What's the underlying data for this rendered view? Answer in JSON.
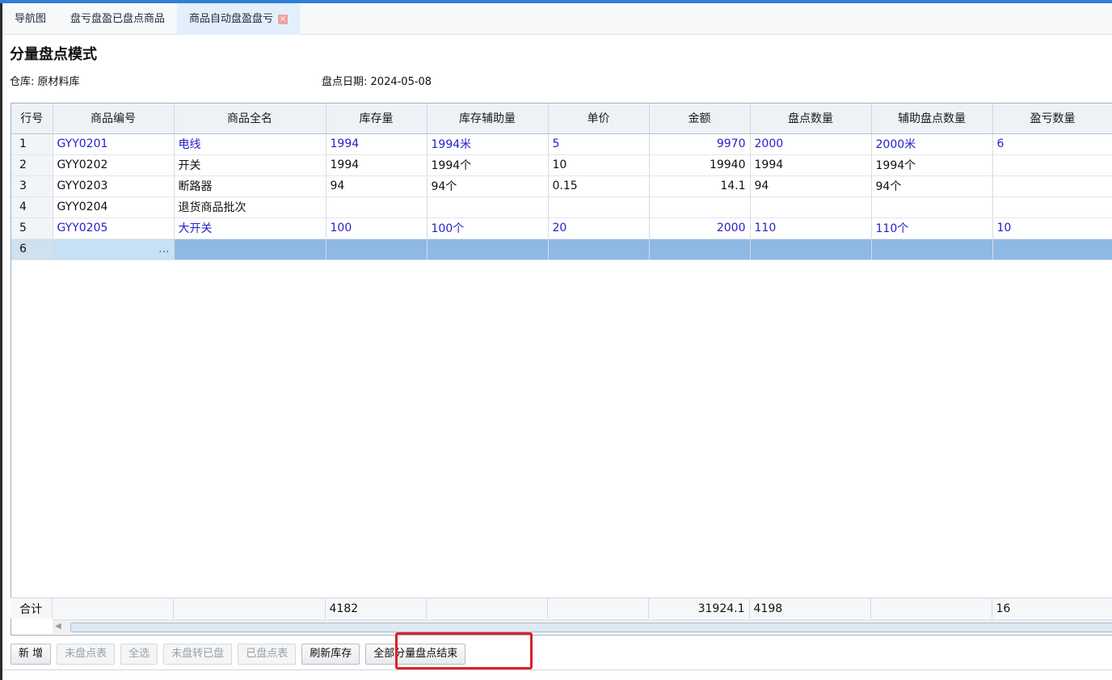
{
  "tabs": [
    {
      "label": "导航图"
    },
    {
      "label": "盘亏盘盈已盘点商品"
    },
    {
      "label": "商品自动盘盈盘亏"
    }
  ],
  "page": {
    "title": "分量盘点模式",
    "warehouse_label": "仓库:",
    "warehouse_value": "原材料库",
    "date_label": "盘点日期:",
    "date_value": "2024-05-08"
  },
  "grid": {
    "columns": [
      "行号",
      "商品编号",
      "商品全名",
      "库存量",
      "库存辅助量",
      "单价",
      "金额",
      "盘点数量",
      "辅助盘点数量",
      "盈亏数量"
    ],
    "rows": [
      {
        "no": "1",
        "code": "GYY0201",
        "name": "电线",
        "stock": "1994",
        "stock_aux": "1994米",
        "price": "5",
        "amount": "9970",
        "count": "2000",
        "count_aux": "2000米",
        "diff": "6"
      },
      {
        "no": "2",
        "code": "GYY0202",
        "name": "开关",
        "stock": "1994",
        "stock_aux": "1994个",
        "price": "10",
        "amount": "19940",
        "count": "1994",
        "count_aux": "1994个",
        "diff": ""
      },
      {
        "no": "3",
        "code": "GYY0203",
        "name": "断路器",
        "stock": "94",
        "stock_aux": "94个",
        "price": "0.15",
        "amount": "14.1",
        "count": "94",
        "count_aux": "94个",
        "diff": ""
      },
      {
        "no": "4",
        "code": "GYY0204",
        "name": "退货商品批次",
        "stock": "",
        "stock_aux": "",
        "price": "",
        "amount": "",
        "count": "",
        "count_aux": "",
        "diff": ""
      },
      {
        "no": "5",
        "code": "GYY0205",
        "name": "大开关",
        "stock": "100",
        "stock_aux": "100个",
        "price": "20",
        "amount": "2000",
        "count": "110",
        "count_aux": "110个",
        "diff": "10"
      },
      {
        "no": "6",
        "code": "...",
        "name": "",
        "stock": "",
        "stock_aux": "",
        "price": "",
        "amount": "",
        "count": "",
        "count_aux": "",
        "diff": ""
      }
    ],
    "summary": {
      "label": "合计",
      "stock": "4182",
      "amount": "31924.1",
      "count": "4198",
      "diff": "16"
    }
  },
  "buttons": {
    "add": "新 增",
    "uncounted": "未盘点表",
    "select_all": "全选",
    "uncounted_to_counted": "未盘转已盘",
    "counted": "已盘点表",
    "refresh_stock": "刷新库存",
    "finish_all": "全部分量盘点结束"
  },
  "colors": {
    "accent": "#2f7fd6",
    "highlight_row_text": "#2222cc",
    "selected_row": "#8db9e2",
    "annotation_box": "#e02020"
  }
}
